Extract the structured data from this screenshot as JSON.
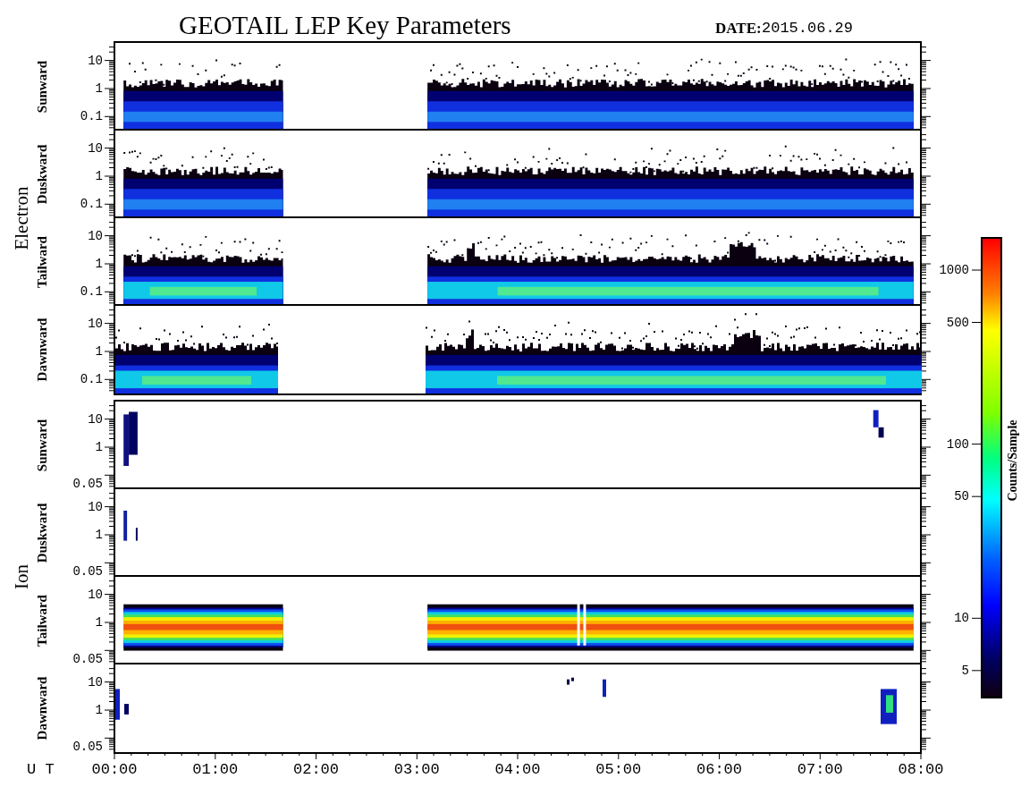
{
  "title": "GEOTAIL LEP Key Parameters",
  "date_label": "DATE:",
  "date": "2015.06.29",
  "groups": [
    {
      "name": "Electron",
      "kind": "electron",
      "panels": [
        {
          "direction": "Sunward",
          "yticks": [
            "10",
            "1",
            "0.1"
          ]
        },
        {
          "direction": "Duskward",
          "yticks": [
            "10",
            "1",
            "0.1"
          ]
        },
        {
          "direction": "Tailward",
          "yticks": [
            "10",
            "1",
            "0.1"
          ]
        },
        {
          "direction": "Dawnward",
          "yticks": [
            "10",
            "1",
            "0.1"
          ]
        }
      ]
    },
    {
      "name": "Ion",
      "kind": "ion",
      "panels": [
        {
          "direction": "Sunward",
          "yticks": [
            "10",
            "1",
            "0.05"
          ]
        },
        {
          "direction": "Duskward",
          "yticks": [
            "10",
            "1",
            "0.05"
          ]
        },
        {
          "direction": "Tailward",
          "yticks": [
            "10",
            "1",
            "0.05"
          ]
        },
        {
          "direction": "Dawnward",
          "yticks": [
            "10",
            "1",
            "0.05"
          ]
        }
      ]
    }
  ],
  "colorbar": {
    "label": "Counts/Sample",
    "ticks": [
      "1000",
      "500",
      "100",
      "50",
      "10",
      "5"
    ]
  },
  "time_axis": {
    "label": "U T",
    "ticks": [
      "00:00",
      "01:00",
      "02:00",
      "03:00",
      "04:00",
      "05:00",
      "06:00",
      "07:00",
      "08:00"
    ]
  }
}
